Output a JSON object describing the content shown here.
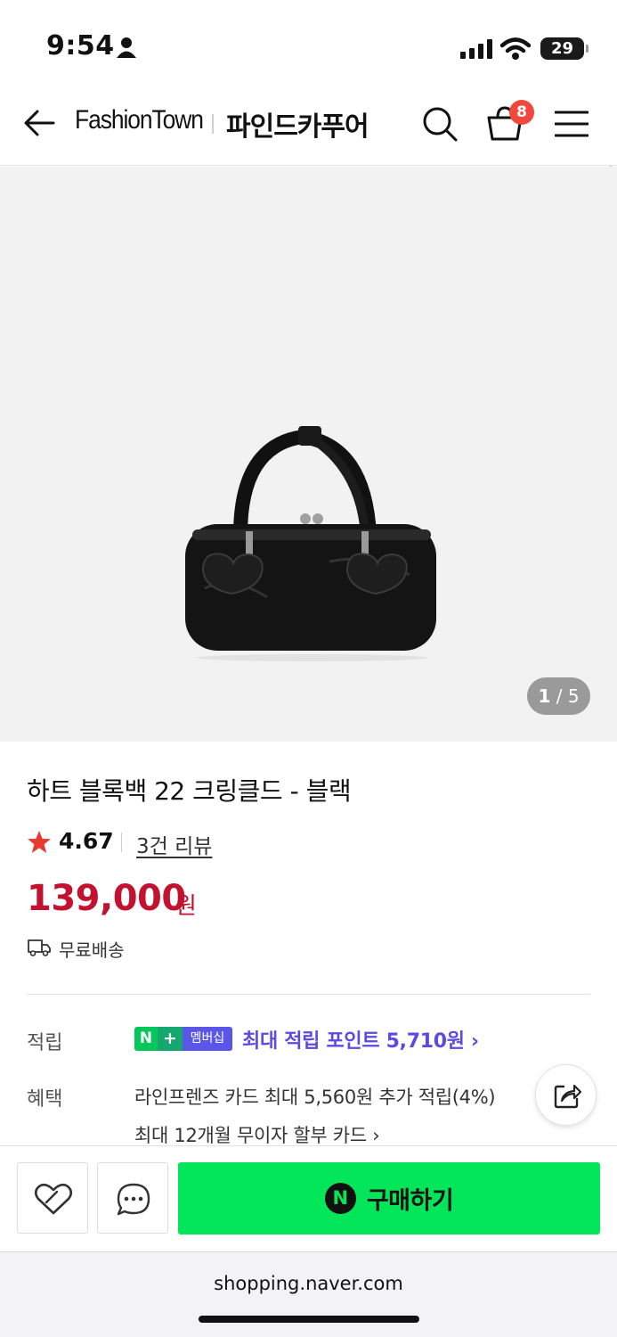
{
  "status_bar": {
    "time": "9:54",
    "battery": "29"
  },
  "header": {
    "brand": "FashionTown",
    "store_name": "파인드카푸어",
    "cart_count": "8",
    "icons": [
      "back-arrow-icon",
      "search-icon",
      "cart-icon",
      "menu-icon"
    ]
  },
  "gallery": {
    "current": "1",
    "separator": "/",
    "total": "5"
  },
  "product": {
    "title": "하트 블록백 22 크링클드 - 블랙",
    "rating": "4.67",
    "review_link": "3건 리뷰",
    "price": "139,000",
    "currency": "원",
    "shipping": "무료배송"
  },
  "points_row": {
    "label": "적립",
    "badge_n": "N",
    "badge_plus": "+",
    "badge_membership": "멤버십",
    "text": "최대 적립 포인트 5,710원 ›"
  },
  "benefits_row": {
    "label": "혜택",
    "line1": "라인프렌즈 카드 최대 5,560원 추가 적립(4%)",
    "line2": "최대 12개월 무이자 할부 카드 ›"
  },
  "bottom_bar": {
    "buy_icon_letter": "N",
    "buy_label": "구매하기"
  },
  "browser": {
    "url": "shopping.naver.com"
  },
  "colors": {
    "price": "#c3122f",
    "buy_button": "#03e65a",
    "cart_badge": "#f0483c",
    "points": "#5b4be0",
    "star": "#e8392f"
  }
}
